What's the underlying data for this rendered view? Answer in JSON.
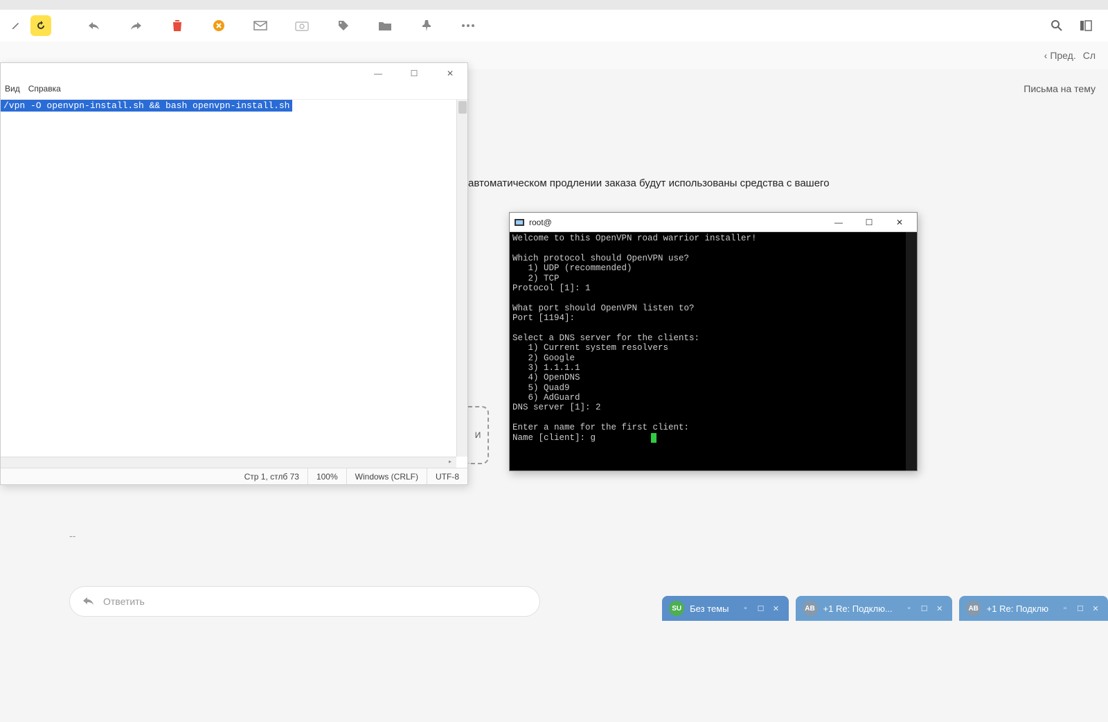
{
  "toolbar": {
    "icons": {
      "back": "back-arrow",
      "forward": "forward-arrow",
      "delete": "trash",
      "spam": "spam",
      "mail": "mail",
      "snapshot": "camera",
      "tag": "tag",
      "folder": "folder",
      "pin": "pin",
      "more": "more",
      "search": "search",
      "toggle": "panel-toggle"
    }
  },
  "nav": {
    "prev": "Пред.",
    "next_initial": "Сл"
  },
  "side_label": "Письма на тему",
  "background_text": "автоматическом продлении заказа будут использованы средства с вашего",
  "dotted_peek_label": "И",
  "dash": "--",
  "reply": {
    "placeholder": "Ответить"
  },
  "notepad": {
    "menu": {
      "view": "Вид",
      "help": "Справка"
    },
    "selected_line": "/vpn -O openvpn-install.sh && bash openvpn-install.sh",
    "status": {
      "pos": "Стр 1, стлб 73",
      "zoom": "100%",
      "eol": "Windows (CRLF)",
      "enc": "UTF-8"
    }
  },
  "terminal": {
    "title": "root@",
    "lines": [
      "Welcome to this OpenVPN road warrior installer!",
      "",
      "Which protocol should OpenVPN use?",
      "   1) UDP (recommended)",
      "   2) TCP",
      "Protocol [1]: 1",
      "",
      "What port should OpenVPN listen to?",
      "Port [1194]:",
      "",
      "Select a DNS server for the clients:",
      "   1) Current system resolvers",
      "   2) Google",
      "   3) 1.1.1.1",
      "   4) OpenDNS",
      "   5) Quad9",
      "   6) AdGuard",
      "DNS server [1]: 2",
      "",
      "Enter a name for the first client:",
      "Name [client]: g"
    ]
  },
  "tasktabs": [
    {
      "badge": "SU",
      "badge_class": "green",
      "label": "Без темы",
      "class": "blue"
    },
    {
      "badge": "AB",
      "badge_class": "grey",
      "label": "+1  Re: Подклю...",
      "class": "blue2"
    },
    {
      "badge": "AB",
      "badge_class": "grey",
      "label": "+1  Re: Подклю",
      "class": "blue3"
    }
  ]
}
